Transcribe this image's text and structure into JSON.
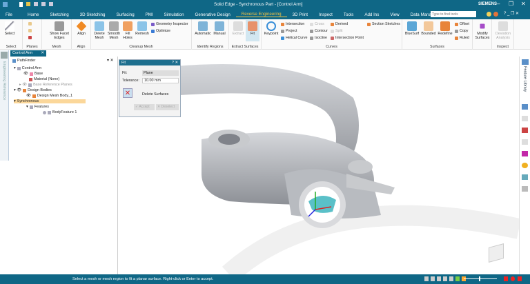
{
  "window": {
    "title": "Solid Edge - Synchronous Part - [Control Arm]",
    "brand": "SIEMENS"
  },
  "menu_tabs": [
    "File",
    "Home",
    "Sketching",
    "3D Sketching",
    "Surfacing",
    "PMI",
    "Simulation",
    "Generative Design",
    "Reverse Engineering",
    "3D Print",
    "Inspect",
    "Tools",
    "Add Ins",
    "View",
    "Data Management"
  ],
  "active_tab": "Reverse Engineering",
  "search": {
    "placeholder": "Type to find tools"
  },
  "ribbon": {
    "select": {
      "button": "Select",
      "group": "Select"
    },
    "planes": {
      "group": "Planes"
    },
    "mesh": {
      "button": "Show Facet Edges",
      "group": "Mesh"
    },
    "align": {
      "button": "Align",
      "group": "Align"
    },
    "cleanup": {
      "buttons": [
        "Delete Mesh",
        "Smooth Mesh",
        "Fill Holes",
        "Remesh"
      ],
      "small": [
        "Geometry Inspector",
        "Optimize"
      ],
      "group": "Cleanup Mesh"
    },
    "identify": {
      "buttons": [
        "Automatic",
        "Manual"
      ],
      "group": "Identify Regions"
    },
    "extract": {
      "buttons": [
        "Extract",
        "Fit"
      ],
      "group": "Extract Surfaces"
    },
    "curves": {
      "button": "Keypoint",
      "col1": [
        "Intersection",
        "Project",
        "Helical Curve"
      ],
      "col2": [
        "Cross",
        "Contour",
        "Isocline"
      ],
      "col3": [
        "Derived",
        "Split",
        "Intersection Point"
      ],
      "col4": [
        "Section Sketches"
      ],
      "group": "Curves"
    },
    "surfaces": {
      "buttons": [
        "BlueSurf",
        "Bounded",
        "Redefine"
      ],
      "small": [
        "Offset",
        "Copy",
        "Ruled"
      ],
      "group": "Surfaces"
    },
    "modify": {
      "button": "Modify Surfaces"
    },
    "inspect": {
      "button": "Deviation Analysis",
      "group": "Inspect"
    }
  },
  "document_tab": "Control Arm",
  "left_strip_label": "Engineering Reference",
  "pathfinder": {
    "title": "PathFinder",
    "items": [
      "Control Arm",
      "Base",
      "Material (None)",
      "Base Reference Planes",
      "Design Bodies",
      "Design Mesh Body_1",
      "Synchronous",
      "Features",
      "BodyFeature 1"
    ]
  },
  "fit_dialog": {
    "title": "Fit",
    "fit_label": "Fit:",
    "fit_value": "Plane",
    "tolerance_label": "Tolerance:",
    "tolerance_value": "10.00 mm",
    "delete_surfaces": "Delete Surfaces",
    "accept": "Accept",
    "deselect": "Deselect"
  },
  "right_panel": {
    "label": "Feature Library"
  },
  "status": {
    "message": "Select a mesh or mesh region to fit a planar surface. Right-click or Enter to accept."
  },
  "colors": {
    "chrome": "#0f6786",
    "active_tab": "#f5c342",
    "selected_row": "#fbd79a"
  }
}
